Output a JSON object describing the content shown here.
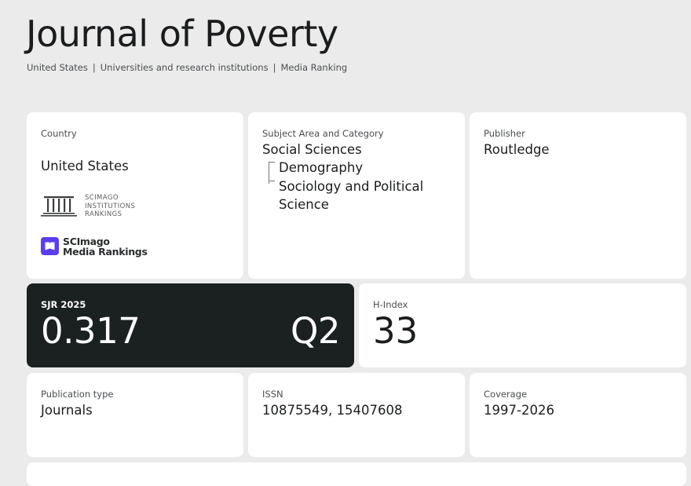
{
  "journal": {
    "title": "Journal of Poverty"
  },
  "breadcrumb": {
    "country": "United States",
    "category": "Universities and research institutions",
    "media": "Media Ranking",
    "separator": "|"
  },
  "country_card": {
    "label": "Country",
    "value": "United States",
    "institutions_logo_text_1": "SCIMAGO",
    "institutions_logo_text_2": "INSTITUTIONS",
    "institutions_logo_text_3": "RANKINGS",
    "media_logo_text_1": "SCImago",
    "media_logo_text_2": "Media Rankings"
  },
  "subject_card": {
    "label": "Subject Area and Category",
    "area": "Social Sciences",
    "categories": [
      "Demography",
      "Sociology and Political Science"
    ]
  },
  "publisher_card": {
    "label": "Publisher",
    "value": "Routledge"
  },
  "sjr_card": {
    "label": "SJR 2025",
    "value": "0.317",
    "quartile": "Q2"
  },
  "hindex_card": {
    "label": "H-Index",
    "value": "33"
  },
  "pubtype_card": {
    "label": "Publication type",
    "value": "Journals"
  },
  "issn_card": {
    "label": "ISSN",
    "value": "10875549, 15407608"
  },
  "coverage_card": {
    "label": "Coverage",
    "value": "1997-2026"
  },
  "colors": {
    "background": "#ebebeb",
    "card": "#ffffff",
    "sjr_card": "#1b2021",
    "media_logo": "#5b3ef0"
  }
}
